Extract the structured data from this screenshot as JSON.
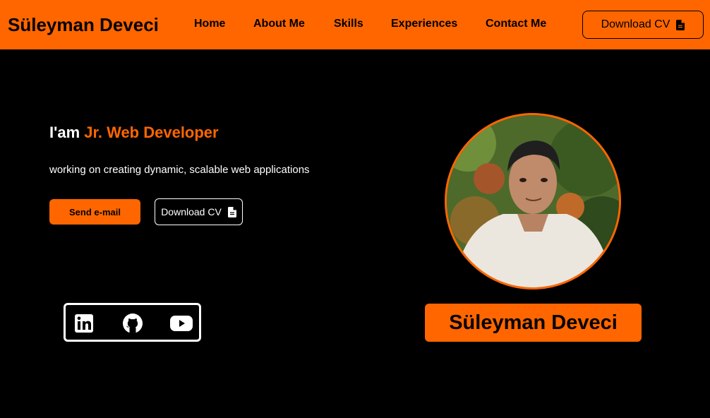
{
  "header": {
    "brand": "Süleyman Deveci",
    "nav": [
      {
        "label": "Home"
      },
      {
        "label": "About Me"
      },
      {
        "label": "Skills"
      },
      {
        "label": "Experiences"
      },
      {
        "label": "Contact Me"
      }
    ],
    "cv_button": {
      "label": "Download CV",
      "icon": "document-icon"
    }
  },
  "hero": {
    "greeting": "I'am",
    "role": "Jr. Web Developer",
    "description": "working on creating dynamic, scalable web applications",
    "email_button": "Send e-mail",
    "cv_button": {
      "label": "Download CV",
      "icon": "document-icon"
    }
  },
  "socials": [
    {
      "icon": "linkedin-icon"
    },
    {
      "icon": "github-icon"
    },
    {
      "icon": "youtube-icon"
    }
  ],
  "profile": {
    "name": "Süleyman Deveci",
    "photo": "profile-photo"
  },
  "colors": {
    "accent": "#ff6600",
    "background": "#000000",
    "text": "#ffffff"
  }
}
